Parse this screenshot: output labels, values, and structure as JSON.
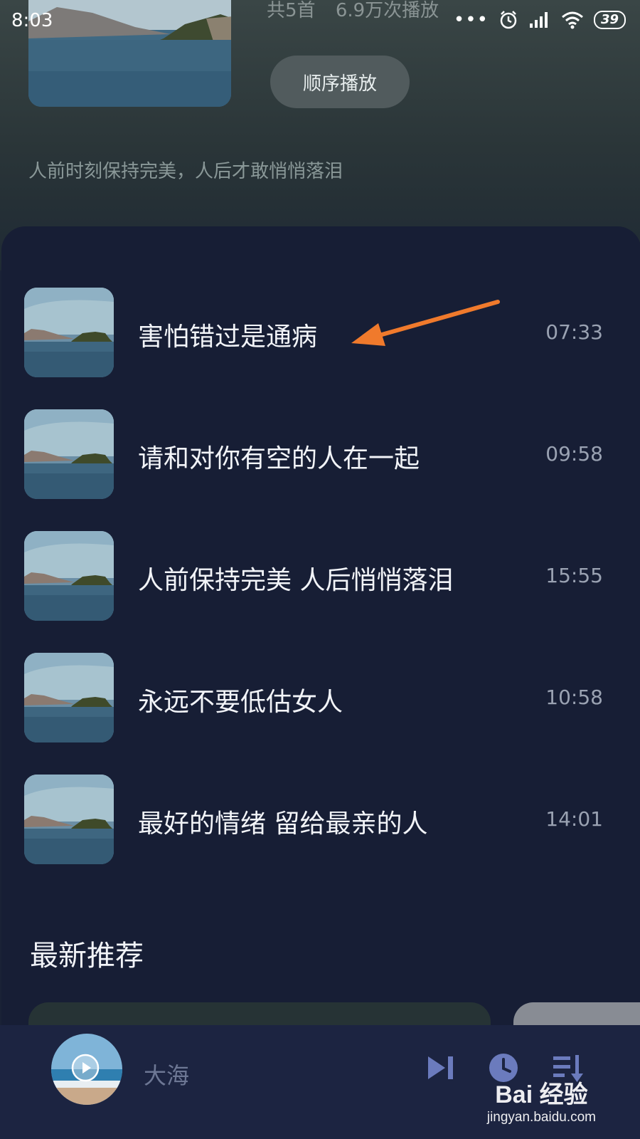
{
  "status_bar": {
    "time": "8:03",
    "more": "•••",
    "battery": "39"
  },
  "header": {
    "stats_count": "共5首",
    "stats_plays": "6.9万次播放",
    "play_order_label": "顺序播放",
    "description": "人前时刻保持完美，人后才敢悄悄落泪"
  },
  "songs": [
    {
      "title": "害怕错过是通病",
      "duration": "07:33"
    },
    {
      "title": "请和对你有空的人在一起",
      "duration": "09:58"
    },
    {
      "title": "人前保持完美 人后悄悄落泪",
      "duration": "15:55"
    },
    {
      "title": "永远不要低估女人",
      "duration": "10:58"
    },
    {
      "title": "最好的情绪 留给最亲的人",
      "duration": "14:01"
    }
  ],
  "recommend": {
    "title": "最新推荐"
  },
  "player": {
    "title": "大海",
    "icons": [
      "play-icon",
      "next-icon",
      "timer-icon",
      "playlist-icon"
    ]
  },
  "watermark": {
    "logo": "Bai 经验",
    "url": "jingyan.baidu.com"
  },
  "colors": {
    "accent_arrow": "#f07a2c",
    "panel_bg": "#171e35",
    "player_bg": "#1c2441"
  }
}
